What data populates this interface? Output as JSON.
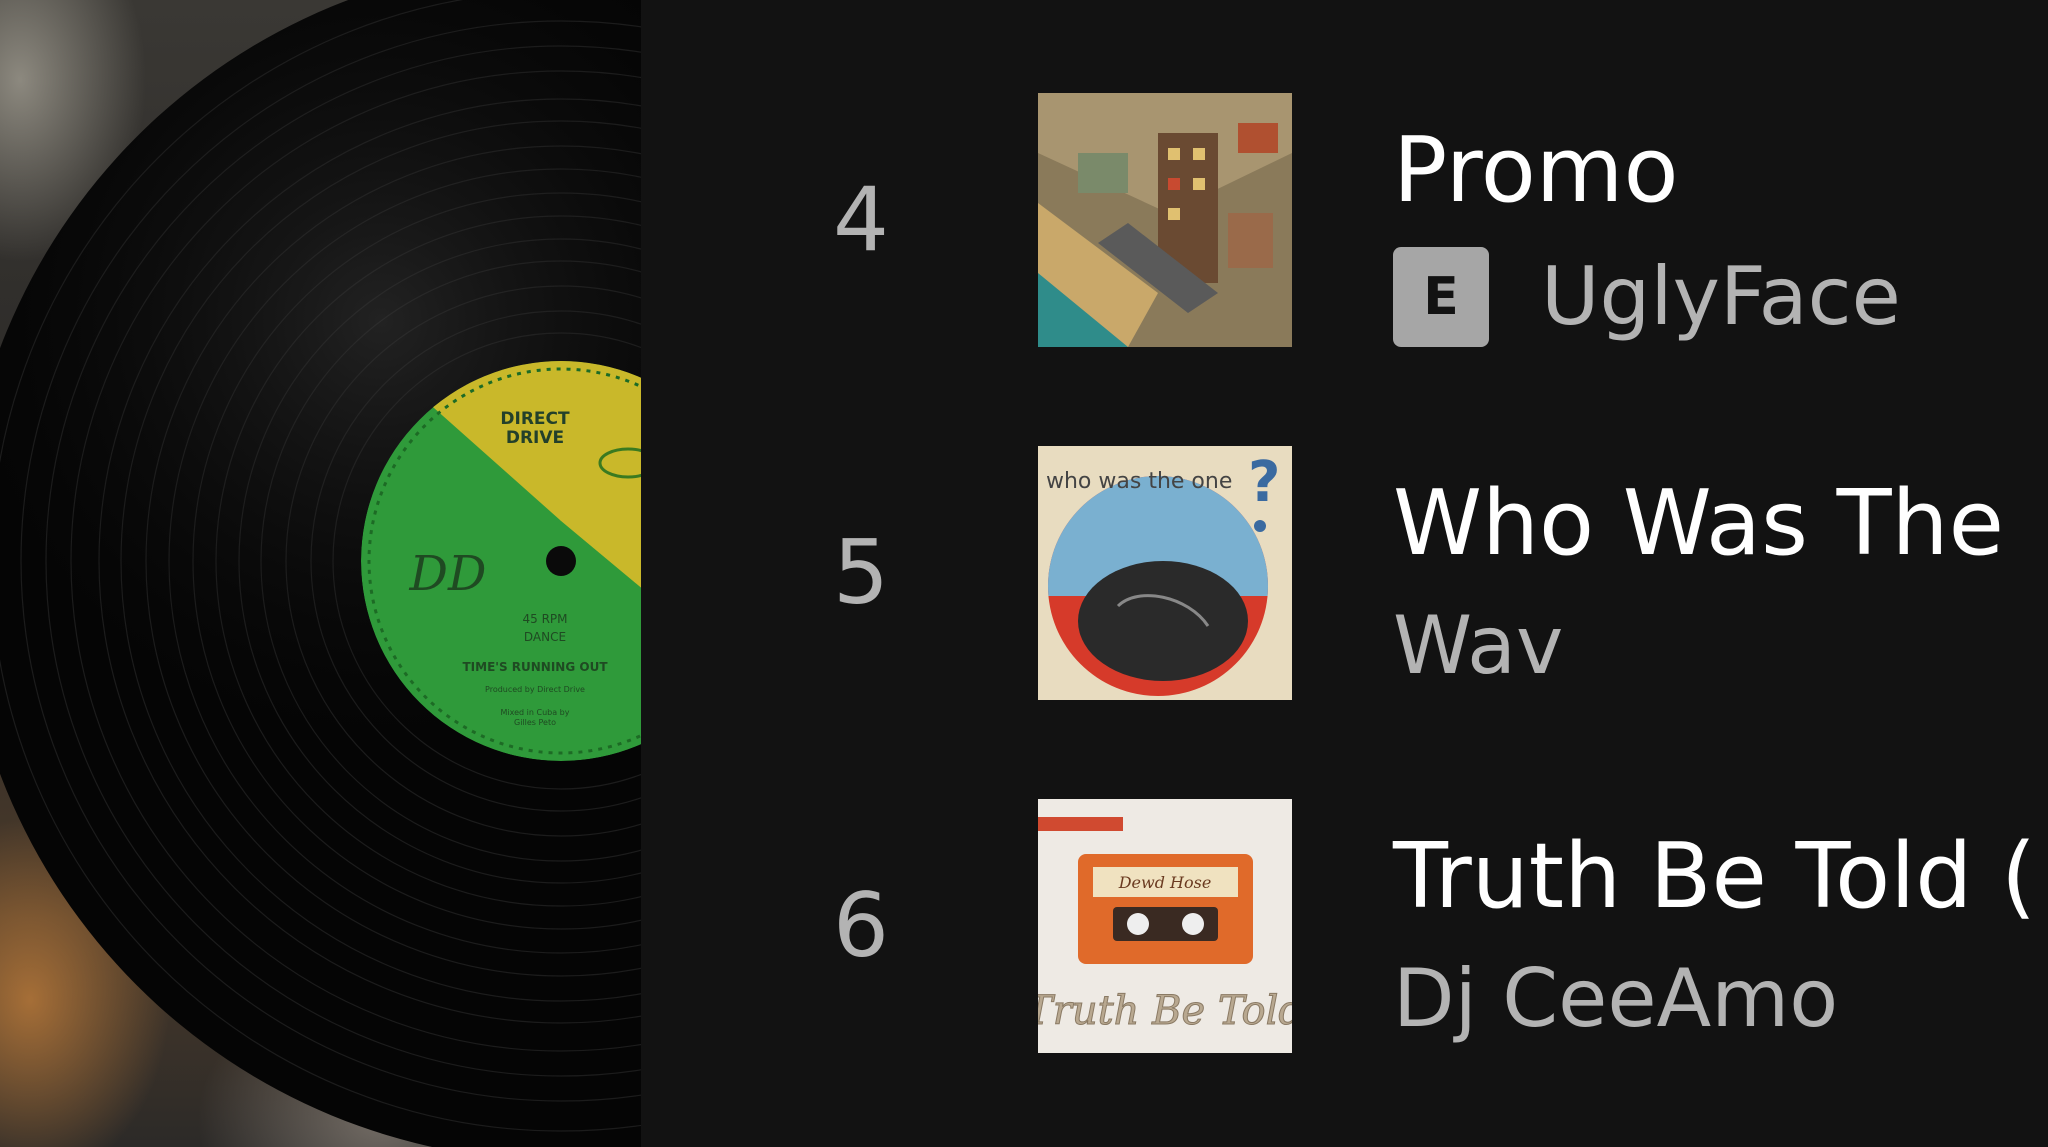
{
  "record": {
    "label_top": "DIRECT",
    "label_top2": "DRIVE",
    "speed": "45 RPM",
    "genre": "DANCE",
    "song": "TIME'S RUNNING OUT",
    "credit1": "Produced by Direct Drive",
    "credit2": "Mixed in Cuba by",
    "credit3": "Gilles Peto"
  },
  "tracks": [
    {
      "number": "4",
      "title": "Promo",
      "explicit": true,
      "explicit_label": "E",
      "artist": "UglyFace"
    },
    {
      "number": "5",
      "title": "Who Was The",
      "explicit": false,
      "artist": "Wav",
      "art_text": "who was the one"
    },
    {
      "number": "6",
      "title": "Truth Be Told (",
      "explicit": false,
      "artist": "Dj CeeAmo",
      "art_text": "Truth Be Told",
      "art_tape_text": "Dewd Hose"
    }
  ],
  "colors": {
    "background": "#121212",
    "title": "#ffffff",
    "secondary": "#b3b3b3",
    "badge": "#a6a6a6",
    "label_green": "#2f9a3a",
    "label_yellow": "#c9b82a"
  },
  "icons": {
    "explicit": "explicit-badge-icon"
  }
}
